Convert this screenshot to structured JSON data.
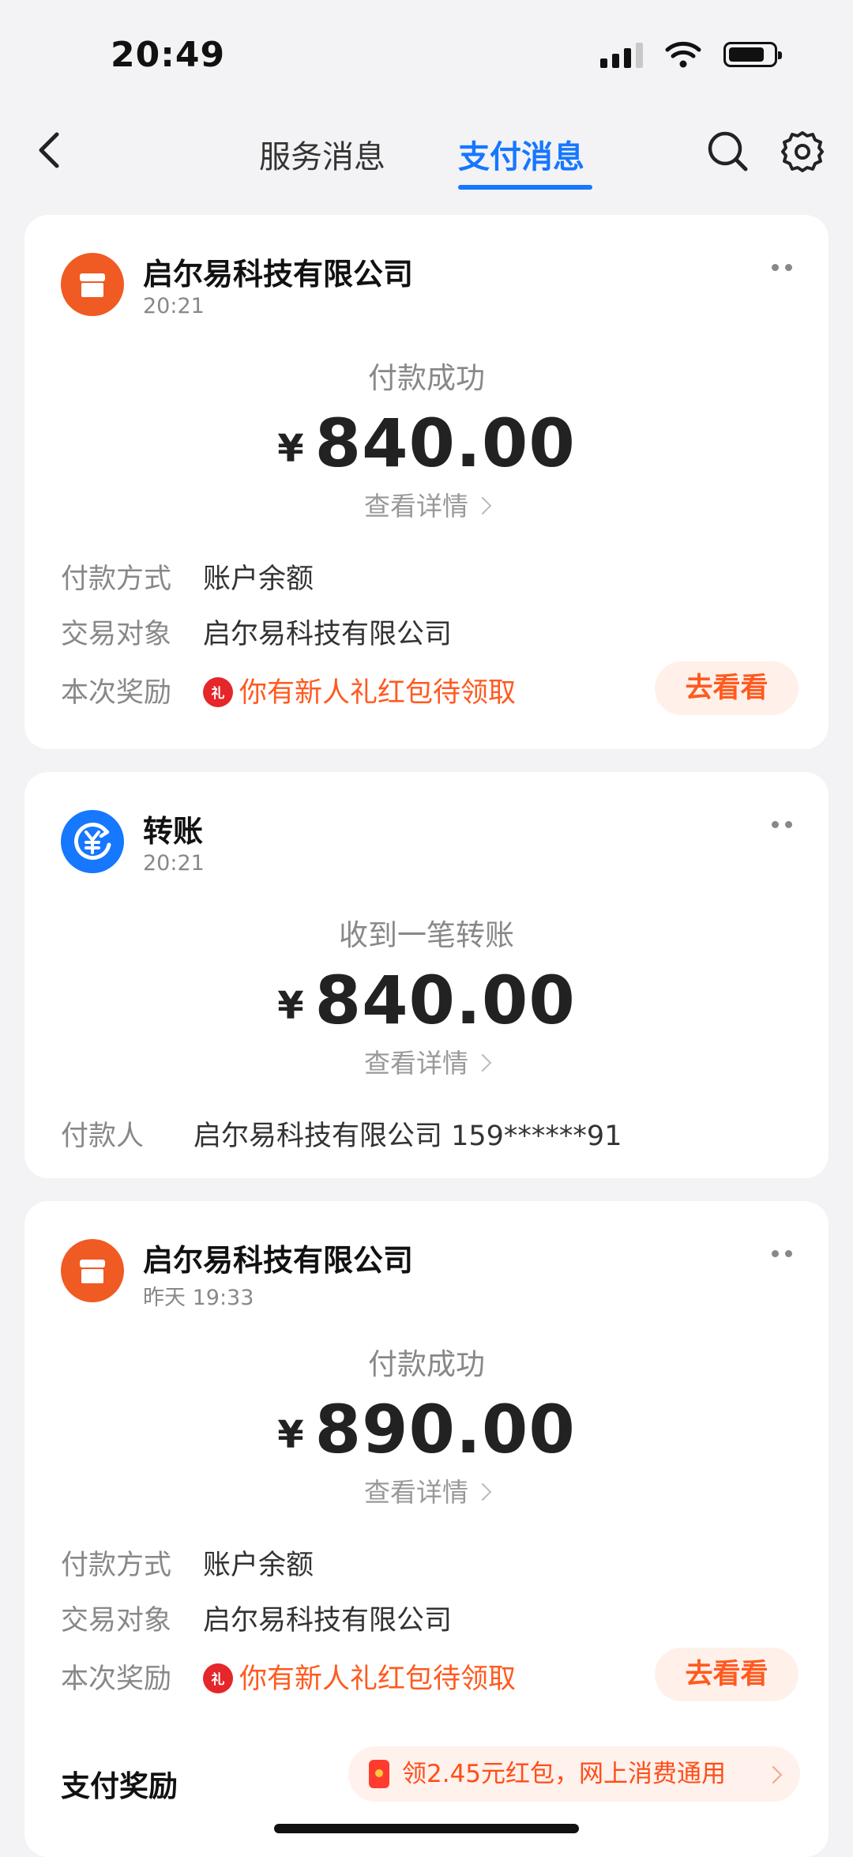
{
  "status_bar": {
    "time": "20:49"
  },
  "header": {
    "tabs": [
      {
        "label": "服务消息",
        "active": false
      },
      {
        "label": "支付消息",
        "active": true
      }
    ]
  },
  "cards": [
    {
      "merchant": "启尔易科技有限公司",
      "time": "20:21",
      "status": "付款成功",
      "currency": "¥",
      "amount": "840.00",
      "detail": "查看详情",
      "rows": [
        {
          "label": "付款方式",
          "value": "账户余额"
        },
        {
          "label": "交易对象",
          "value": "启尔易科技有限公司"
        },
        {
          "label": "本次奖励",
          "value": "你有新人礼红包待领取"
        }
      ],
      "button": "去看看"
    },
    {
      "merchant": "转账",
      "time": "20:21",
      "status": "收到一笔转账",
      "currency": "¥",
      "amount": "840.00",
      "detail": "查看详情",
      "rows": [
        {
          "label": "付款人",
          "value": "启尔易科技有限公司 159******91"
        }
      ]
    },
    {
      "merchant": "启尔易科技有限公司",
      "time": "昨天 19:33",
      "status": "付款成功",
      "currency": "¥",
      "amount": "890.00",
      "detail": "查看详情",
      "rows": [
        {
          "label": "付款方式",
          "value": "账户余额"
        },
        {
          "label": "交易对象",
          "value": "启尔易科技有限公司"
        },
        {
          "label": "本次奖励",
          "value": "你有新人礼红包待领取"
        }
      ],
      "button": "去看看",
      "bonus": {
        "label": "支付奖励",
        "text": "领2.45元红包，网上消费通用"
      }
    }
  ],
  "colors": {
    "accent": "#1677ff",
    "merchant_logo": "#f05a23",
    "reward": "#ff5a1f"
  }
}
